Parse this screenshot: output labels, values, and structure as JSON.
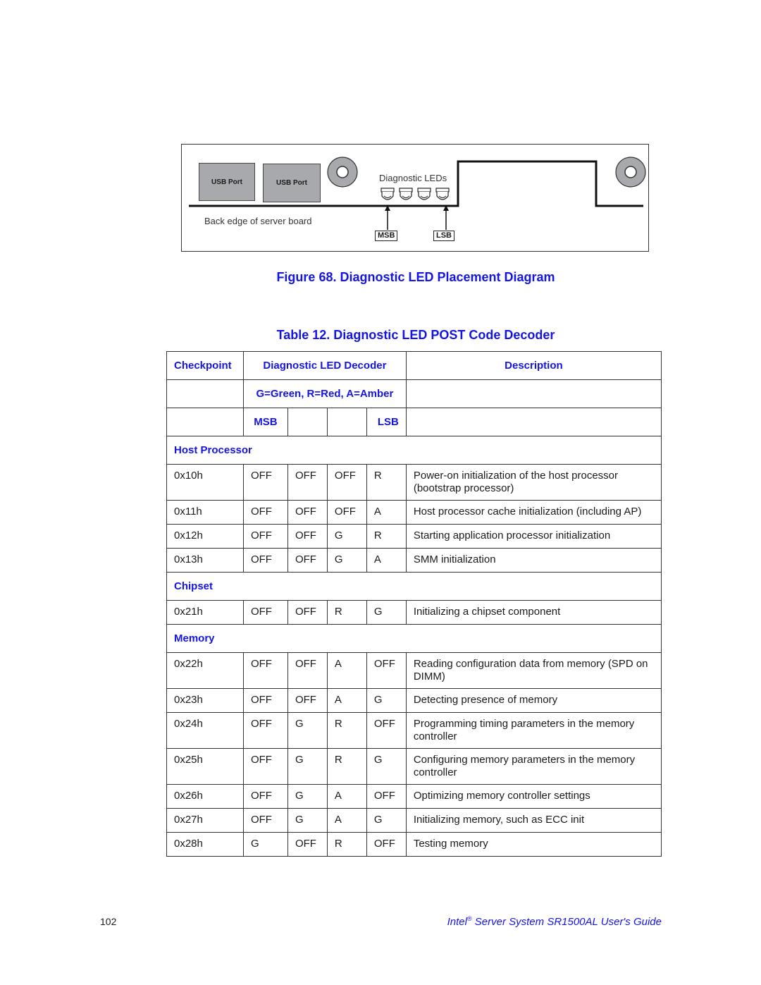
{
  "figure": {
    "usb_port_1": "USB Port",
    "usb_port_2": "USB Port",
    "leds_label": "Diagnostic LEDs",
    "edge_label": "Back edge of server board",
    "msb_tag": "MSB",
    "lsb_tag": "LSB",
    "led_count": 4,
    "caption": "Figure 68. Diagnostic LED Placement Diagram"
  },
  "table": {
    "caption": "Table 12. Diagnostic LED POST Code Decoder",
    "headers": {
      "checkpoint": "Checkpoint",
      "decoder": "Diagnostic LED Decoder",
      "description": "Description",
      "legend": "G=Green, R=Red, A=Amber",
      "msb": "MSB",
      "lsb": "LSB"
    },
    "sections": [
      {
        "title": "Host Processor",
        "rows": [
          {
            "code": "0x10h",
            "leds": [
              "OFF",
              "OFF",
              "OFF",
              "R"
            ],
            "description": "Power-on initialization of the host processor (bootstrap processor)"
          },
          {
            "code": "0x11h",
            "leds": [
              "OFF",
              "OFF",
              "OFF",
              "A"
            ],
            "description": "Host processor cache initialization (including AP)"
          },
          {
            "code": "0x12h",
            "leds": [
              "OFF",
              "OFF",
              "G",
              "R"
            ],
            "description": "Starting application processor initialization"
          },
          {
            "code": "0x13h",
            "leds": [
              "OFF",
              "OFF",
              "G",
              "A"
            ],
            "description": "SMM initialization"
          }
        ]
      },
      {
        "title": "Chipset",
        "rows": [
          {
            "code": "0x21h",
            "leds": [
              "OFF",
              "OFF",
              "R",
              "G"
            ],
            "description": "Initializing a chipset component"
          }
        ]
      },
      {
        "title": "Memory",
        "rows": [
          {
            "code": "0x22h",
            "leds": [
              "OFF",
              "OFF",
              "A",
              "OFF"
            ],
            "description": "Reading configuration data from memory (SPD on DIMM)"
          },
          {
            "code": "0x23h",
            "leds": [
              "OFF",
              "OFF",
              "A",
              "G"
            ],
            "description": "Detecting presence of memory"
          },
          {
            "code": "0x24h",
            "leds": [
              "OFF",
              "G",
              "R",
              "OFF"
            ],
            "description": "Programming timing parameters in the memory controller"
          },
          {
            "code": "0x25h",
            "leds": [
              "OFF",
              "G",
              "R",
              "G"
            ],
            "description": "Configuring memory parameters in the memory controller"
          },
          {
            "code": "0x26h",
            "leds": [
              "OFF",
              "G",
              "A",
              "OFF"
            ],
            "description": "Optimizing memory controller settings"
          },
          {
            "code": "0x27h",
            "leds": [
              "OFF",
              "G",
              "A",
              "G"
            ],
            "description": "Initializing memory, such as ECC init"
          },
          {
            "code": "0x28h",
            "leds": [
              "G",
              "OFF",
              "R",
              "OFF"
            ],
            "description": "Testing memory"
          }
        ]
      }
    ]
  },
  "footer": {
    "page_number": "102",
    "brand": "Intel",
    "registered": "®",
    "guide_title": " Server System SR1500AL User's Guide"
  },
  "colors": {
    "heading_blue": "#1414e6",
    "usb_gray": "#a7a9ac"
  }
}
